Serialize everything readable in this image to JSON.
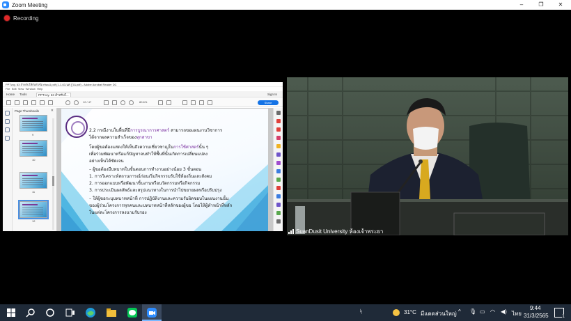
{
  "window": {
    "title": "Zoom Meeting",
    "controls": {
      "minimize": "–",
      "maximize": "❐",
      "close": "✕"
    }
  },
  "recording": {
    "label": "Recording"
  },
  "shared_screen": {
    "app_title": "PPTvoy. 63 สำหรับให้กับหัวข้อ rfisa.อ.pdf (1-1-63-นศ.รู่วน.pdf) - Adobe Acrobat Reader DC",
    "menu": [
      "File",
      "Edit",
      "View",
      "Window",
      "Help"
    ],
    "tabs": [
      "Home",
      "Tools",
      "PPTvoy. 63 สำหรับใ..."
    ],
    "sign_in": "Sign In",
    "page_indicator": "12 / 47",
    "zoom_level": "80.6%",
    "share_button": "Share",
    "thumbnails_panel": {
      "title": "Page Thumbnails",
      "close": "✕",
      "page_numbers": [
        "9",
        "10",
        "11",
        "12"
      ]
    },
    "slide": {
      "lines": [
        {
          "pre": "2.2 กรณีงานในพื้นที่มี",
          "hl": "การบูรณาการศาสตร์",
          "post": " สามารถขอแผนงานวิชาการ"
        },
        {
          "pre": "ได้จากผลความสำเร็จของ",
          "hl": "ทุกสาขา",
          "post": ""
        },
        {
          "pre": "     โดยผู้ขอต้องแสดงให้เห็นถึงความเชี่ยวชาญใน",
          "hl": "การใช้ศาสตร์",
          "post": "นั้น ๆ"
        },
        {
          "pre": "เพื่อร่วมพัฒนาหรือแก้ปัญหาจนทำให้พื้นที่นั้นเกิดการเปลี่ยนแปลง",
          "hl": "",
          "post": ""
        },
        {
          "pre": "อย่างเห็นได้ชัดเจน",
          "hl": "",
          "post": ""
        },
        {
          "pre": "   – ผู้ขอต้องมีบทบาทในขั้นตอนการทำงานอย่างน้อย 3 ขั้นตอน",
          "hl": "",
          "post": ""
        },
        {
          "pre": "          1. การวิเคราะห์สถานการณ์ก่อนเริ่มกิจกรรมรับใช้ท้องถิ่นและสังคม",
          "hl": "",
          "post": ""
        },
        {
          "pre": "          2. การออกแบบหรือพัฒนาชิ้นงานหรือนวัตกรรมหรือกิจกรรม",
          "hl": "",
          "post": ""
        },
        {
          "pre": "          3. การประเมินผลลัพธ์และสรุปแนวทางในการนำไปขยายผลหรือปรับปรุง",
          "hl": "",
          "post": ""
        },
        {
          "pre": "   – ให้ผู้ขอระบุบทบาทหน้าที่ การปฏิบัติงานและความรับผิดชอบในแผนงานนั้น",
          "hl": "",
          "post": ""
        },
        {
          "pre": "ของผู้ร่วมโครงการทุกคนและบทบาทหน้าที่หลักของผู้ขอ โดยให้ผู้ทำหน้าที่หลัก",
          "hl": "",
          "post": ""
        },
        {
          "pre": "ในแต่ละโครงการลงนามรับรอง",
          "hl": "",
          "post": ""
        }
      ]
    }
  },
  "video": {
    "participant_name": "SuanDusit University ห้องเจ้าพระยา"
  },
  "taskbar": {
    "weather": "31°C",
    "weather_text": "มีแดดส่วนใหญ่",
    "language": "ไทย",
    "time": "9:44",
    "date": "31/3/2565",
    "notification_count": "1"
  },
  "colors": {
    "accent_purple": "#7a2fa0",
    "acrobat_blue": "#1473e6",
    "taskbar": "#1f2a38",
    "recording_red": "#e02828"
  }
}
